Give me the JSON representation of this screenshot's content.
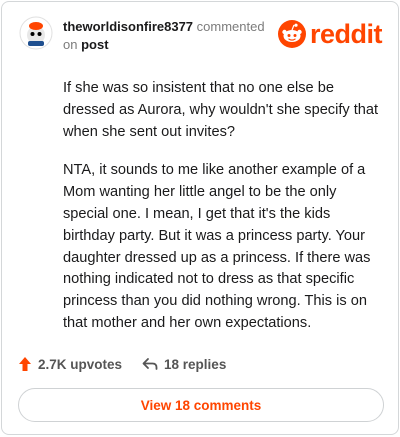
{
  "comment": {
    "username": "theworldisonfire8377",
    "action_text": "commented",
    "on_text": "on",
    "post_link": "post",
    "paragraphs": [
      "If she was so insistent that no one else be dressed as Aurora, why wouldn't she specify that when she sent out invites?",
      "NTA, it sounds to me like another example of a Mom wanting her little angel to be the only special one. I mean, I get that it's the kids birthday party. But it was a princess party. Your daughter dressed up as a princess. If there was nothing indicated not to dress as that specific princess than you did nothing wrong. This is on that mother and her own expectations."
    ]
  },
  "brand": {
    "name": "reddit",
    "color": "#ff4500"
  },
  "stats": {
    "upvotes": "2.7K upvotes",
    "replies": "18 replies"
  },
  "view_button": "View 18 comments"
}
